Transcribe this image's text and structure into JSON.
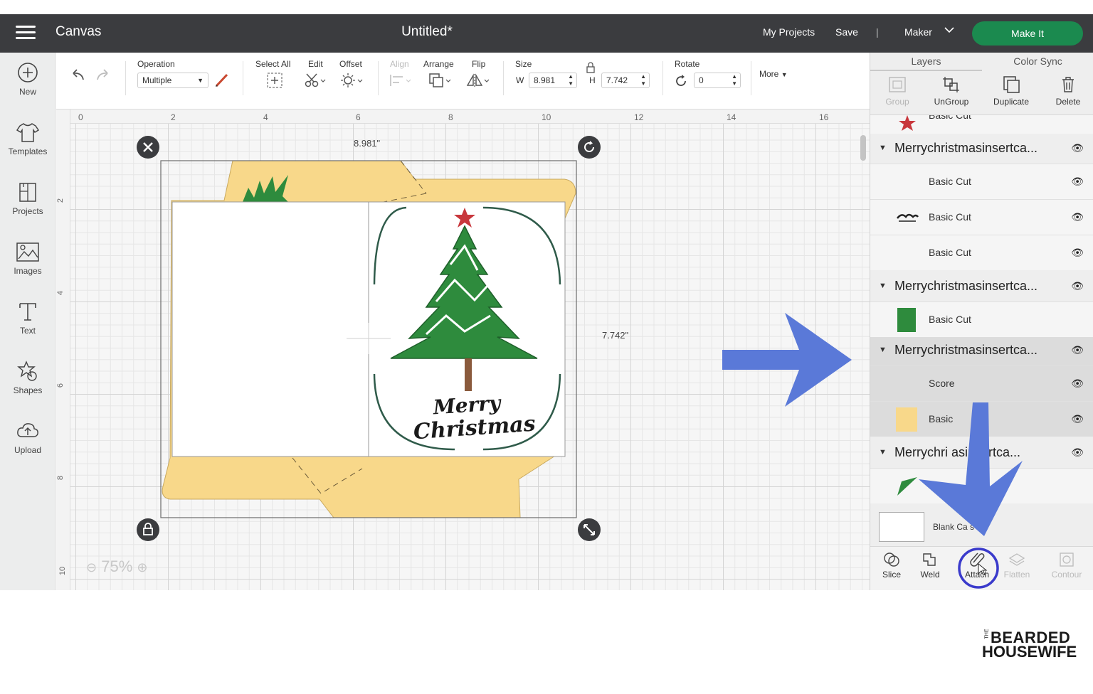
{
  "header": {
    "app_title": "Canvas",
    "doc_title": "Untitled*",
    "my_projects": "My Projects",
    "save": "Save",
    "separator": "|",
    "machine": "Maker",
    "make_it": "Make It",
    "make_it_color": "#1b8a4f"
  },
  "sidebar": {
    "items": [
      {
        "label": "New",
        "icon": "plus-circle-icon"
      },
      {
        "label": "Templates",
        "icon": "shirt-icon"
      },
      {
        "label": "Projects",
        "icon": "projects-icon"
      },
      {
        "label": "Images",
        "icon": "image-icon"
      },
      {
        "label": "Text",
        "icon": "text-icon"
      },
      {
        "label": "Shapes",
        "icon": "shapes-icon"
      },
      {
        "label": "Upload",
        "icon": "upload-cloud-icon"
      }
    ]
  },
  "toolbar": {
    "operation_label": "Operation",
    "operation_value": "Multiple",
    "select_all": "Select All",
    "edit": "Edit",
    "offset": "Offset",
    "align": "Align",
    "arrange": "Arrange",
    "flip": "Flip",
    "size_label": "Size",
    "w_label": "W",
    "w_value": "8.981",
    "h_label": "H",
    "h_value": "7.742",
    "rotate_label": "Rotate",
    "rotate_value": "0",
    "more": "More"
  },
  "canvas": {
    "ruler_top": [
      "0",
      "2",
      "4",
      "6",
      "8",
      "10",
      "12",
      "14",
      "16"
    ],
    "ruler_left": [
      "2",
      "4",
      "6",
      "8",
      "10"
    ],
    "width_readout": "8.981\"",
    "height_readout": "7.742\"",
    "zoom": "75%",
    "card_text_line1": "Merry",
    "card_text_line2": "Christmas",
    "colors": {
      "card_fill": "#f8d88a",
      "tree_green": "#2e8b3d",
      "star_red": "#c8373c",
      "arrow_blue": "#5a79d8"
    }
  },
  "panel": {
    "tabs": [
      "Layers",
      "Color Sync"
    ],
    "tools": [
      {
        "label": "Group",
        "disabled": true
      },
      {
        "label": "UnGroup",
        "disabled": false
      },
      {
        "label": "Duplicate",
        "disabled": false
      },
      {
        "label": "Delete",
        "disabled": false
      }
    ],
    "partial_top": "Basic Cut",
    "groups": [
      {
        "name": "Merrychristmasinsertca...",
        "children": [
          "Basic Cut",
          "Basic Cut",
          "Basic Cut"
        ]
      },
      {
        "name": "Merrychristmasinsertca...",
        "children": [
          "Basic Cut"
        ]
      },
      {
        "name": "Merrychristmasinsertca...",
        "children": [
          "Score",
          "Basic"
        ]
      },
      {
        "name": "Merrychri  asinsertca...",
        "children": [
          "C"
        ]
      }
    ],
    "blank_canvas": "Blank Ca  s",
    "ops": [
      {
        "label": "Slice",
        "disabled": false
      },
      {
        "label": "Weld",
        "disabled": false
      },
      {
        "label": "Attach",
        "disabled": false
      },
      {
        "label": "Flatten",
        "disabled": true
      },
      {
        "label": "Contour",
        "disabled": true
      }
    ]
  },
  "logo": {
    "the": "THE",
    "line1": "BEARDED",
    "line2": "HOUSEWIFE"
  }
}
